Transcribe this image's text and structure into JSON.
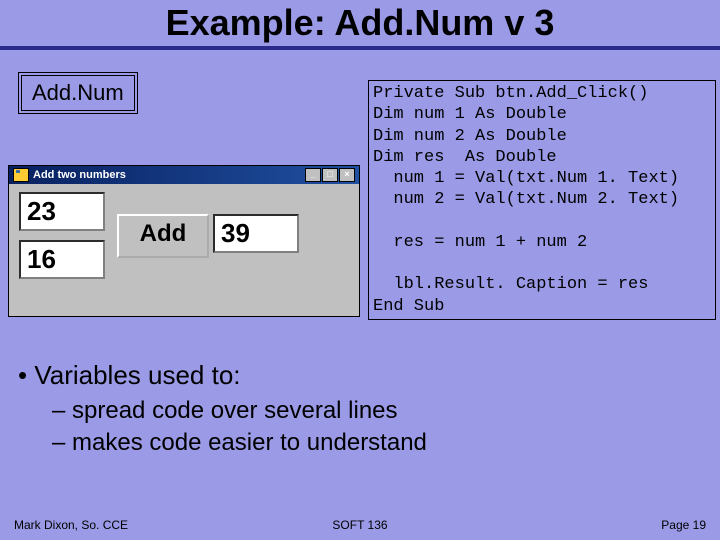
{
  "slide": {
    "title": "Example: Add.Num v 3",
    "label": "Add.Num"
  },
  "app": {
    "windowTitle": "Add two numbers",
    "num1": "23",
    "num2": "16",
    "buttonLabel": "Add",
    "result": "39"
  },
  "code": "Private Sub btn.Add_Click()\nDim num 1 As Double\nDim num 2 As Double\nDim res  As Double\n  num 1 = Val(txt.Num 1. Text)\n  num 2 = Val(txt.Num 2. Text)\n\n  res = num 1 + num 2\n\n  lbl.Result. Caption = res\nEnd Sub",
  "bullets": {
    "main": "Variables used to:",
    "sub1": "spread code over several lines",
    "sub2": "makes code easier to understand"
  },
  "footer": {
    "left": "Mark Dixon, So. CCE",
    "center": "SOFT 136",
    "right": "Page 19"
  }
}
